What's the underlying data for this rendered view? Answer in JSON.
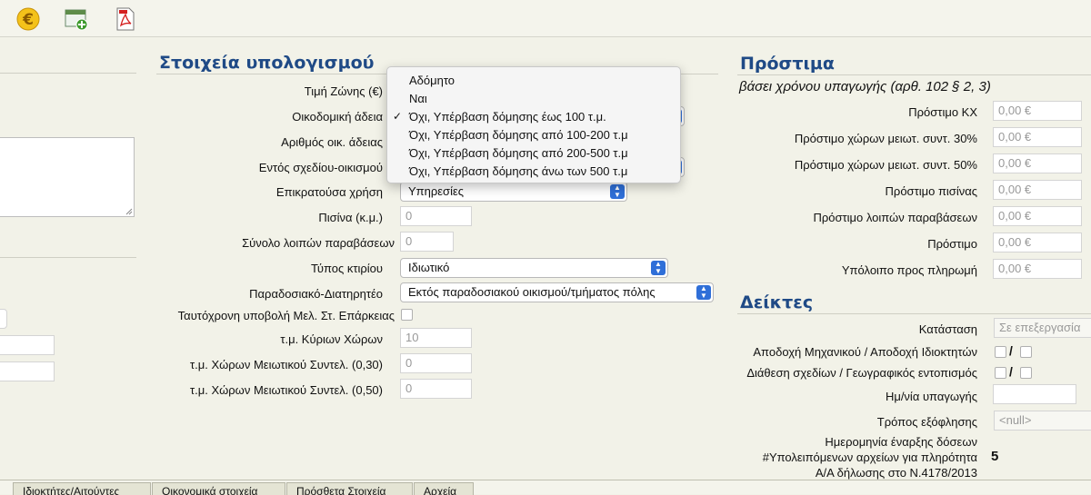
{
  "toolbar": {
    "icons": [
      "euro-icon",
      "add-window-icon",
      "pdf-icon"
    ]
  },
  "calc": {
    "title": "Στοιχεία υπολογισμού",
    "zone_price_label": "Τιμή Ζώνης (€)",
    "permit_label": "Οικοδομική άδεια",
    "permit_number_label": "Αριθμός οικ. άδειας",
    "town_plan_label": "Εντός σχεδίου-οικισμού",
    "use_label": "Επικρατούσα χρήση",
    "use_value": "Υπηρεσίες",
    "pool_label": "Πισίνα (κ.μ.)",
    "pool_value": "0",
    "other_violations_label": "Σύνολο λοιπών παραβάσεων",
    "other_violations_value": "0",
    "building_type_label": "Τύπος κτιρίου",
    "building_type_value": "Ιδιωτικό",
    "traditional_label": "Παραδοσιακό-Διατηρητέο",
    "traditional_value": "Εκτός παραδοσιακού οικισμού/τμήματος πόλης",
    "simultaneous_label": "Ταυτόχρονη υποβολή Μελ. Στ. Επάρκειας",
    "main_area_label": "τ.μ. Κύριων Χώρων",
    "main_area_value": "10",
    "reduced_030_label": "τ.μ. Χώρων Μειωτικού Συντελ. (0,30)",
    "reduced_030_value": "0",
    "reduced_050_label": "τ.μ. Χώρων Μειωτικού Συντελ. (0,50)",
    "reduced_050_value": "0"
  },
  "permit_dropdown": {
    "options": [
      "Αδόμητο",
      "Ναι",
      "Όχι, Υπέρβαση δόμησης έως 100 τ.μ.",
      "Όχι, Υπέρβαση δόμησης από 100-200 τ.μ",
      "Όχι, Υπέρβαση δόμησης από 200-500 τ.μ",
      "Όχι, Υπέρβαση δόμησης άνω των 500 τ.μ"
    ],
    "selected_index": 2,
    "check": "✓"
  },
  "fines": {
    "title": "Πρόστιμα",
    "subtitle": "βάσει χρόνου υπαγωγής (αρθ. 102 § 2, 3)",
    "rows": [
      {
        "label": "Πρόστιμο ΚΧ",
        "value": "0,00 €"
      },
      {
        "label": "Πρόστιμο χώρων μειωτ. συντ. 30%",
        "value": "0,00 €"
      },
      {
        "label": "Πρόστιμο χώρων μειωτ. συντ. 50%",
        "value": "0,00 €"
      },
      {
        "label": "Πρόστιμο πισίνας",
        "value": "0,00 €"
      },
      {
        "label": "Πρόστιμο λοιπών παραβάσεων",
        "value": "0,00 €"
      },
      {
        "label": "Πρόστιμο",
        "value": "0,00 €"
      },
      {
        "label": "Υπόλοιπο προς πληρωμή",
        "value": "0,00 €"
      }
    ]
  },
  "indicators": {
    "title": "Δείκτες",
    "status_label": "Κατάσταση",
    "status_value": "Σε επεξεργασία",
    "engineer_owner_label": "Αποδοχή Μηχανικού / Αποδοχή Ιδιοκτητών",
    "plans_label": "Διάθεση σχεδίων / Γεωγραφικός εντοπισμός",
    "slash": "/",
    "submission_date_label": "Ημ/νία υπαγωγής",
    "payment_method_label": "Τρόπος εξόφλησης",
    "payment_method_value": "<null>",
    "installment_date_label": "Ημερομηνία έναρξης δόσεων",
    "remaining_files_label": "#Υπολειπόμενων αρχείων για πληρότητα",
    "remaining_files_value": "5",
    "declaration_label": "Α/Α δήλωσης στο Ν.4178/2013"
  },
  "tabs": [
    "Ιδιοκτήτες/Αιτούντες",
    "Οικονομικά στοιχεία",
    "Πρόσθετα Στοιχεία",
    "Αρχεία"
  ],
  "colors": {
    "title": "#1f4a86",
    "select_arrow": "#2f6fd8",
    "background": "#f2f2e8"
  }
}
